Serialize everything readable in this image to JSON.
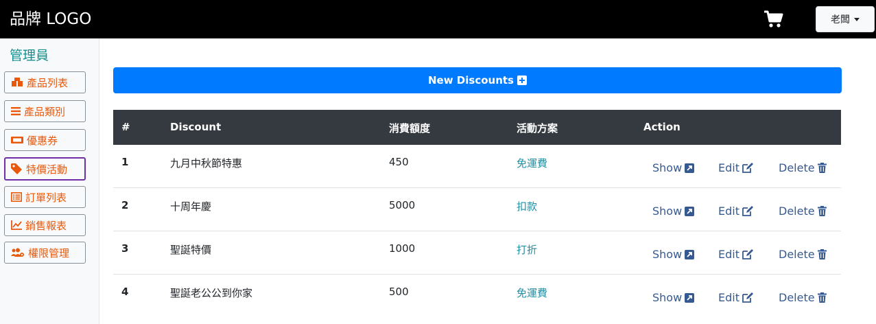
{
  "nav": {
    "brand": "品牌 LOGO",
    "user_label": "老闆"
  },
  "sidebar": {
    "title": "管理員",
    "items": [
      {
        "label": "產品列表",
        "icon": "boxes-icon"
      },
      {
        "label": "產品類別",
        "icon": "list-icon"
      },
      {
        "label": "優惠券",
        "icon": "ticket-icon"
      },
      {
        "label": "特價活動",
        "icon": "tag-icon",
        "active": true
      },
      {
        "label": "訂單列表",
        "icon": "list-alt-icon"
      },
      {
        "label": "銷售報表",
        "icon": "chart-line-icon"
      },
      {
        "label": "權限管理",
        "icon": "users-cog-icon"
      }
    ]
  },
  "main": {
    "new_button": "New Discounts",
    "table": {
      "headers": [
        "#",
        "Discount",
        "消費額度",
        "活動方案",
        "Action"
      ],
      "rows": [
        {
          "id": "1",
          "discount": "九月中秋節特惠",
          "amount": "450",
          "plan": "免運費"
        },
        {
          "id": "2",
          "discount": "十周年慶",
          "amount": "5000",
          "plan": "扣款"
        },
        {
          "id": "3",
          "discount": "聖誕特價",
          "amount": "1000",
          "plan": "打折"
        },
        {
          "id": "4",
          "discount": "聖誕老公公到你家",
          "amount": "500",
          "plan": "免運費"
        }
      ],
      "actions": {
        "show": "Show",
        "edit": "Edit",
        "delete": "Delete"
      }
    }
  },
  "colors": {
    "primary": "#007bff",
    "sidebar_text": "#e8590c",
    "table_head": "#343a40",
    "link": "#355a91"
  }
}
